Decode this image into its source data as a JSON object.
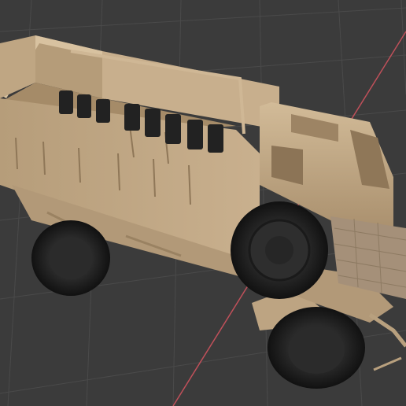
{
  "viewport": {
    "background": "#3b3b3b",
    "grid_color": "#4a4a4a",
    "x_axis_color": "#c0505a",
    "model": {
      "name": "armored-troop-truck",
      "body_color": "#c2a987",
      "tire_color": "#1e1e1e",
      "seat_color": "#222222"
    }
  }
}
